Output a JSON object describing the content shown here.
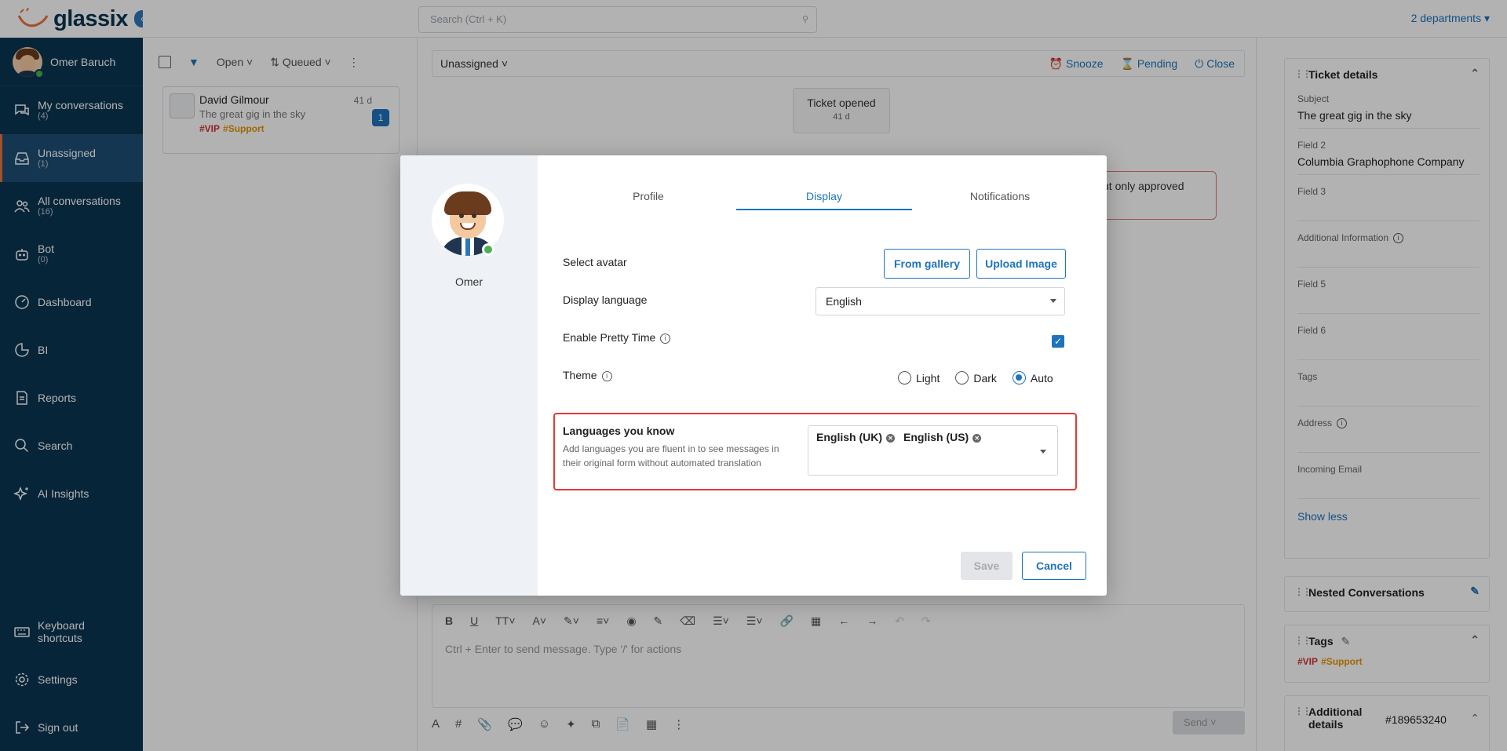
{
  "app": {
    "brand": "glassix",
    "collapse_glyph": "‹"
  },
  "topbar": {
    "search_placeholder": "Search (Ctrl + K)",
    "departments": "2 departments ▾"
  },
  "user": {
    "name": "Omer Baruch"
  },
  "sidebar": {
    "items": [
      {
        "label": "My conversations",
        "count": "(4)",
        "icon": "chat-icon"
      },
      {
        "label": "Unassigned",
        "count": "(1)",
        "icon": "inbox-icon",
        "active": true
      },
      {
        "label": "All conversations",
        "count": "(16)",
        "icon": "users-icon"
      },
      {
        "label": "Bot",
        "count": "(0)",
        "icon": "bot-icon"
      },
      {
        "label": "Dashboard",
        "icon": "dashboard-icon"
      },
      {
        "label": "BI",
        "icon": "chart-icon"
      },
      {
        "label": "Reports",
        "icon": "document-icon"
      },
      {
        "label": "Search",
        "icon": "search-icon"
      },
      {
        "label": "AI Insights",
        "icon": "sparkle-icon"
      }
    ],
    "bottom": [
      {
        "label": "Keyboard shortcuts",
        "icon": "keyboard-icon"
      },
      {
        "label": "Settings",
        "icon": "gear-icon"
      },
      {
        "label": "Sign out",
        "icon": "signout-icon"
      }
    ]
  },
  "list": {
    "filter_open": "Open",
    "sort_queued": "Queued",
    "conversation": {
      "name": "David Gilmour",
      "subject": "The great gig in the sky",
      "tag_vip": "#VIP",
      "tag_support": "#Support",
      "age": "41 d",
      "badge": "1"
    }
  },
  "chat": {
    "assign": "Unassigned",
    "actions": {
      "snooze": "Snooze",
      "pending": "Pending",
      "close": "Close"
    },
    "ticket_opened": "Ticket opened",
    "ticket_age": "41 d",
    "bubble_text": "ut only approved",
    "editor_placeholder": "Ctrl + Enter to send message. Type '/' for actions",
    "send": "Send"
  },
  "details": {
    "title": "Ticket details",
    "fields": [
      {
        "label": "Subject",
        "value": "The great gig in the sky"
      },
      {
        "label": "Field 2",
        "value": "Columbia Graphophone Company"
      },
      {
        "label": "Field 3",
        "value": ""
      },
      {
        "label": "Additional Information",
        "value": ""
      },
      {
        "label": "Field 5",
        "value": ""
      },
      {
        "label": "Field 6",
        "value": ""
      },
      {
        "label": "Tags",
        "value": ""
      },
      {
        "label": "Address",
        "value": ""
      },
      {
        "label": "Incoming Email",
        "value": ""
      }
    ],
    "show_less": "Show less",
    "nested": "Nested Conversations",
    "tags_title": "Tags",
    "tag_vip": "#VIP",
    "tag_support": "#Support",
    "additional_title": "Additional details",
    "ticket_id": "#189653240"
  },
  "modal": {
    "user": "Omer",
    "tabs": {
      "profile": "Profile",
      "display": "Display",
      "notifications": "Notifications"
    },
    "select_avatar": "Select avatar",
    "from_gallery": "From gallery",
    "upload_image": "Upload Image",
    "display_language": "Display language",
    "display_language_value": "English",
    "pretty_time": "Enable Pretty Time",
    "pretty_time_checked": true,
    "theme": "Theme",
    "theme_options": {
      "light": "Light",
      "dark": "Dark",
      "auto": "Auto"
    },
    "theme_selected": "Auto",
    "languages_title": "Languages you know",
    "languages_desc": "Add languages you are fluent in to see messages in their original form without automated translation",
    "languages": [
      "English (UK)",
      "English (US)"
    ],
    "save": "Save",
    "cancel": "Cancel"
  },
  "colors": {
    "sidebar": "#0b3552",
    "accent": "#1e73be",
    "highlight": "#e53935",
    "vip": "#d32f2f",
    "support": "#e69500"
  }
}
